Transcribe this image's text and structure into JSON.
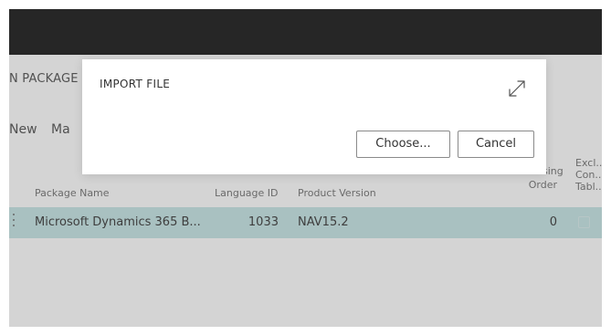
{
  "page": {
    "title": "N PACKAGE",
    "actions": [
      "New",
      "Ma"
    ]
  },
  "table": {
    "headers": {
      "package_name": "Package Name",
      "language_id": "Language ID",
      "product_version": "Product Version",
      "processing_order": [
        "Processing",
        "Order"
      ],
      "exclude_config_tables": [
        "Excl...",
        "Con...",
        "Tabl..."
      ]
    },
    "rows": [
      {
        "package_name": "Microsoft Dynamics 365 B...",
        "language_id": "1033",
        "product_version": "NAV15.2",
        "processing_order": "0",
        "exclude_config_tables": false
      }
    ]
  },
  "dialog": {
    "title": "IMPORT FILE",
    "choose_label": "Choose...",
    "cancel_label": "Cancel",
    "expand_icon": "expand-arrows-icon"
  },
  "colors": {
    "topbar": "#262626",
    "overlay_background": "#d4d4d4",
    "selected_row": "#a9c1c1",
    "dialog_background": "#ffffff"
  }
}
